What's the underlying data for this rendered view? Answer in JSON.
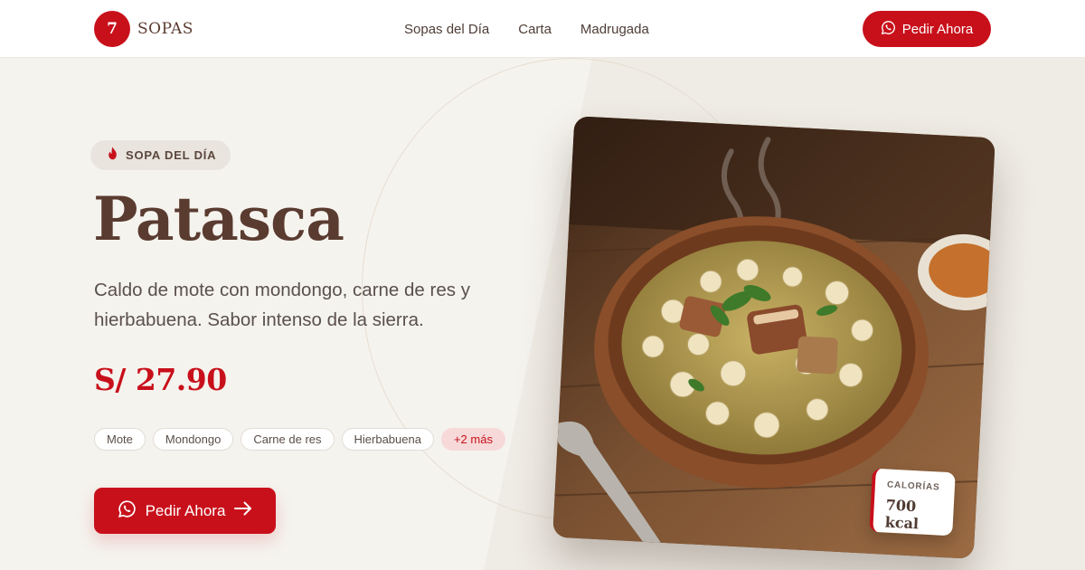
{
  "brand": {
    "badge": "7",
    "name": "SOPAS",
    "accent_color": "#c8101b"
  },
  "nav": {
    "items": [
      {
        "label": "Sopas del Día"
      },
      {
        "label": "Carta"
      },
      {
        "label": "Madrugada"
      }
    ]
  },
  "header": {
    "cta_label": "Pedir Ahora",
    "cta_icon": "whatsapp-icon"
  },
  "hero": {
    "badge": {
      "icon": "flame-icon",
      "label": "SOPA DEL DÍA"
    },
    "title": "Patasca",
    "description": "Caldo de mote con mondongo, carne de res y hierbabuena. Sabor intenso de la sierra.",
    "price": "S/ 27.90",
    "tags": [
      {
        "label": "Mote"
      },
      {
        "label": "Mondongo"
      },
      {
        "label": "Carne de res"
      },
      {
        "label": "Hierbabuena"
      }
    ],
    "more_tag": "+2 más",
    "cta_label": "Pedir Ahora",
    "cta_icons": [
      "whatsapp-icon",
      "arrow-right-icon"
    ]
  },
  "card": {
    "image": "soup-bowl-photo",
    "calories_label": "CALORÍAS",
    "calories_value": "700 kcal"
  }
}
